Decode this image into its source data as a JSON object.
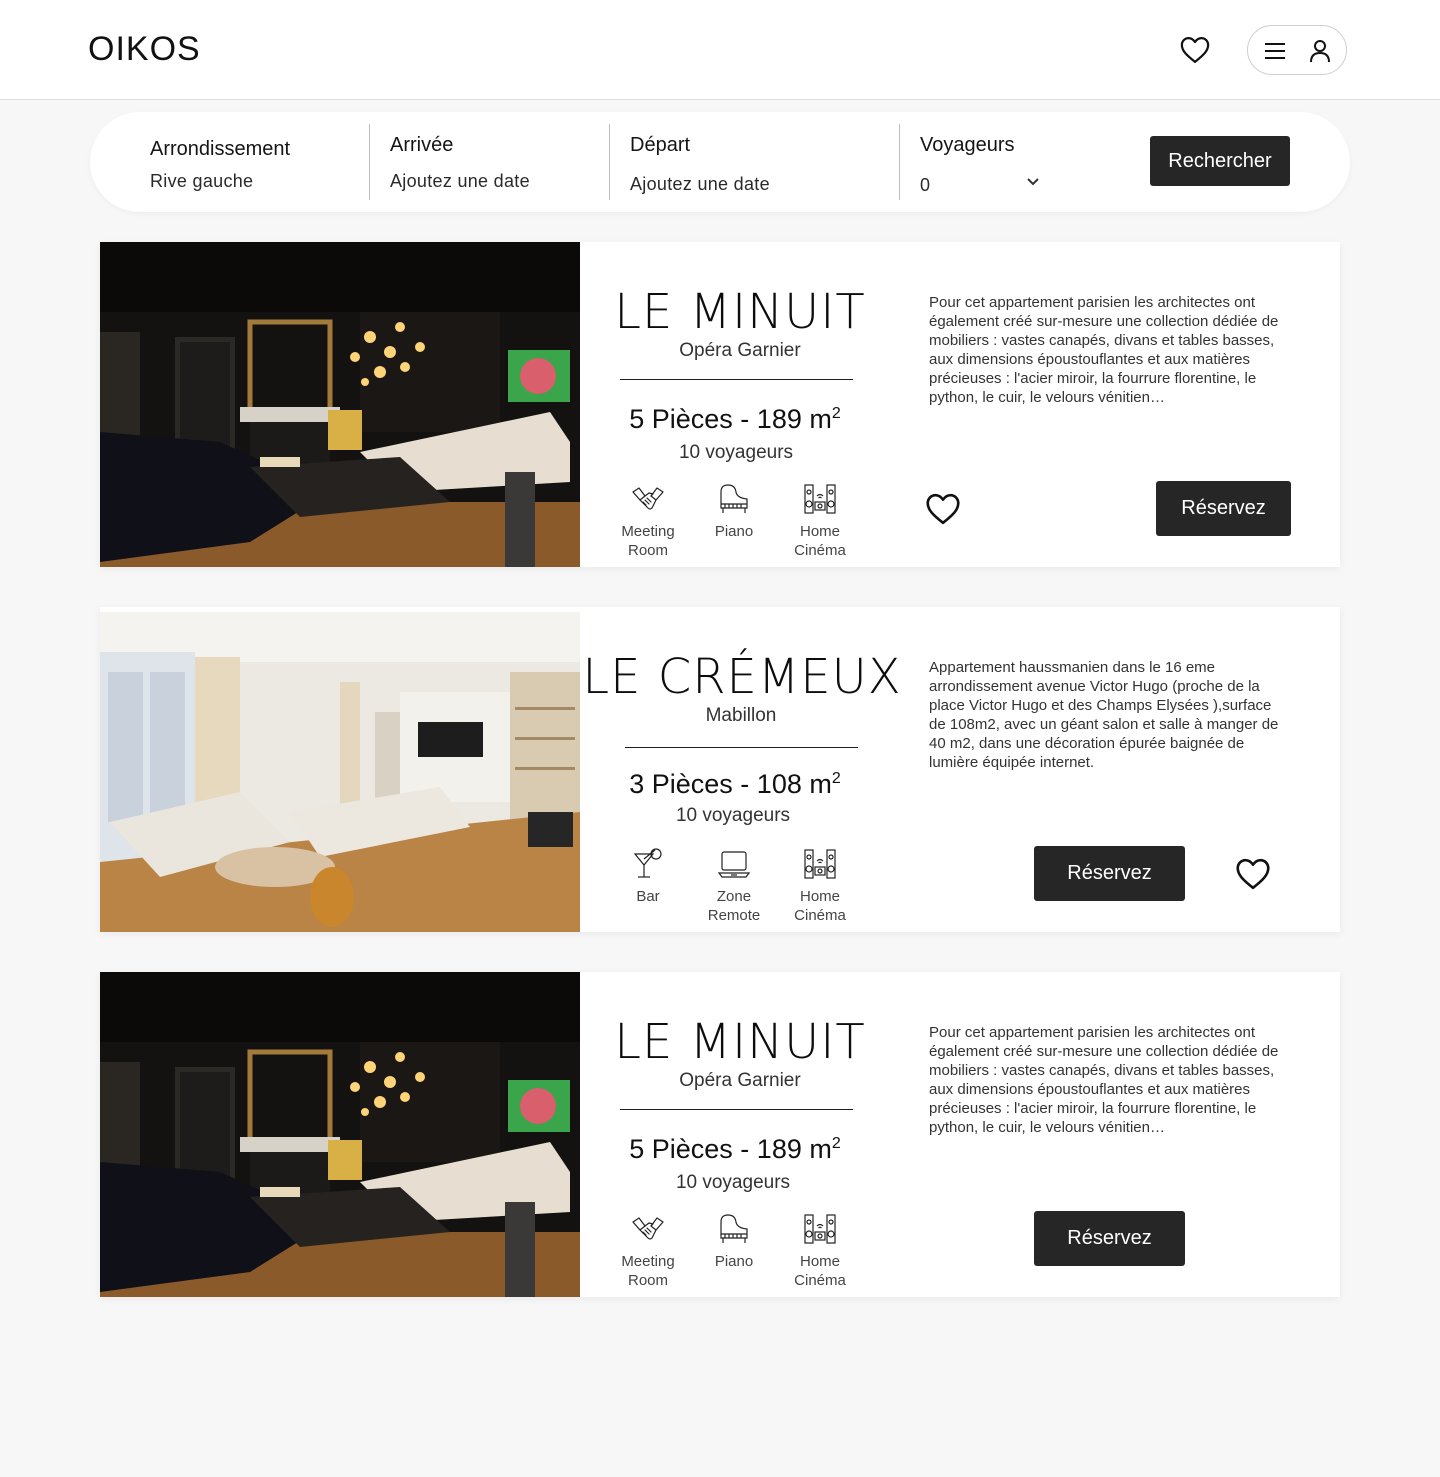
{
  "header": {
    "logo": "OIKOS",
    "favorites_icon": "heart-icon",
    "menu_icon": "hamburger-icon",
    "user_icon": "user-icon"
  },
  "search": {
    "arrondissement_label": "Arrondissement",
    "arrondissement_value": "Rive gauche",
    "arrival_label": "Arrivée",
    "arrival_value": "Ajoutez une date",
    "departure_label": "Départ",
    "departure_value": "Ajoutez une date",
    "travelers_label": "Voyageurs",
    "travelers_value": "0",
    "button": "Rechercher"
  },
  "listings": [
    {
      "title": "LE MINUIT",
      "location": "Opéra Garnier",
      "rooms": "5 Pièces - 189 m",
      "rooms_sup": "2",
      "guests": "10 voyageurs",
      "amenities": [
        {
          "line1": "Meeting",
          "line2": "Room",
          "icon": "handshake-icon"
        },
        {
          "line1": "Piano",
          "line2": "",
          "icon": "piano-icon"
        },
        {
          "line1": "Home",
          "line2": "Cinéma",
          "icon": "speakers-icon"
        }
      ],
      "description": "Pour cet appartement parisien les architectes ont également créé sur-mesure une collection dédiée de mobiliers : vastes canapés, divans et tables basses, aux dimensions époustouflantes et aux matières précieuses : l'acier miroir, la fourrure florentine, le python, le cuir, le velours vénitien…",
      "button": "Réservez",
      "photo": "dark-living-room-photo"
    },
    {
      "title": "LE CRÉMEUX",
      "location": "Mabillon",
      "rooms": "3 Pièces - 108 m",
      "rooms_sup": "2",
      "guests": "10 voyageurs",
      "amenities": [
        {
          "line1": "Bar",
          "line2": "",
          "icon": "cocktail-icon"
        },
        {
          "line1": "Zone",
          "line2": "Remote",
          "icon": "laptop-icon"
        },
        {
          "line1": "Home",
          "line2": "Cinéma",
          "icon": "speakers-icon"
        }
      ],
      "description": "Appartement haussmanien dans le 16 eme arrondissement avenue Victor Hugo (proche de la place Victor Hugo et des Champs Elysées ),surface de 108m2, avec un géant salon et salle à manger de 40 m2, dans une décoration épurée baignée de lumière équipée internet.",
      "button": "Réservez",
      "photo": "bright-living-room-photo"
    },
    {
      "title": "LE MINUIT",
      "location": "Opéra Garnier",
      "rooms": "5 Pièces - 189 m",
      "rooms_sup": "2",
      "guests": "10 voyageurs",
      "amenities": [
        {
          "line1": "Meeting",
          "line2": "Room",
          "icon": "handshake-icon"
        },
        {
          "line1": "Piano",
          "line2": "",
          "icon": "piano-icon"
        },
        {
          "line1": "Home",
          "line2": "Cinéma",
          "icon": "speakers-icon"
        }
      ],
      "description": "Pour cet appartement parisien les architectes ont également créé sur-mesure une collection dédiée de mobiliers : vastes canapés, divans et tables basses, aux dimensions époustouflantes et aux matières précieuses : l'acier miroir, la fourrure florentine, le python, le cuir, le velours vénitien…",
      "button": "Réservez",
      "photo": "dark-living-room-photo"
    }
  ]
}
